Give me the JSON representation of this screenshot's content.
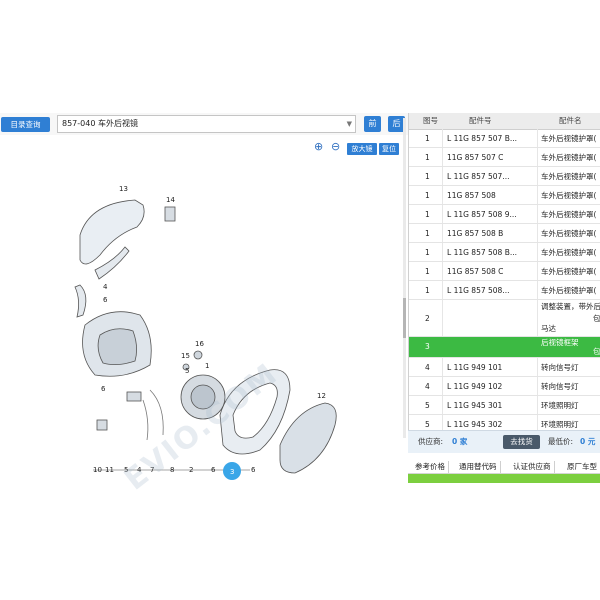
{
  "toolbar": {
    "catalog_label": "目录查询",
    "model_value": "857-040 车外后视镜",
    "prev_label": "前",
    "next_label": "后"
  },
  "diagram_tools": {
    "zoom_in_icon": "zoom-in-icon",
    "zoom_out_icon": "zoom-out-icon",
    "magnifier_label": "放大镜",
    "reset_label": "复位"
  },
  "callouts": [
    "13",
    "14",
    "4",
    "6",
    "16",
    "15",
    "5",
    "1",
    "6",
    "10",
    "11",
    "5",
    "4",
    "7",
    "8",
    "2",
    "6",
    "3",
    "6",
    "12"
  ],
  "table": {
    "headers": [
      "图号",
      "配件号",
      "配件名"
    ],
    "rows": [
      {
        "fig": "1",
        "part": "L 11G 857 507 B...",
        "name": "车外后视镜护罩("
      },
      {
        "fig": "1",
        "part": "11G 857 507 C",
        "name": "车外后视镜护罩("
      },
      {
        "fig": "1",
        "part": "L 11G 857 507...",
        "name": "车外后视镜护罩("
      },
      {
        "fig": "1",
        "part": "11G 857 508",
        "name": "车外后视镜护罩("
      },
      {
        "fig": "1",
        "part": "L 11G 857 508 9...",
        "name": "车外后视镜护罩("
      },
      {
        "fig": "1",
        "part": "11G 857 508 B",
        "name": "车外后视镜护罩("
      },
      {
        "fig": "1",
        "part": "L 11G 857 508 B...",
        "name": "车外后视镜护罩("
      },
      {
        "fig": "1",
        "part": "11G 857 508 C",
        "name": "车外后视镜护罩("
      },
      {
        "fig": "1",
        "part": "L 11G 857 508...",
        "name": "车外后视镜护罩("
      }
    ],
    "tall_row": {
      "fig": "2",
      "part": "",
      "name_line1": "调整装置，带外后",
      "name_line2": "马达",
      "extra": "包"
    },
    "highlight_row": {
      "fig": "3",
      "part": "",
      "name": "后视镜框架",
      "extra": "包"
    },
    "rows_after": [
      {
        "fig": "4",
        "part": "L 11G 949 101",
        "name": "转向信号灯"
      },
      {
        "fig": "4",
        "part": "L 11G 949 102",
        "name": "转向信号灯"
      },
      {
        "fig": "5",
        "part": "L 11G 945 301",
        "name": "环境照明灯"
      },
      {
        "fig": "5",
        "part": "L 11G 945 302",
        "name": "环境照明灯"
      }
    ]
  },
  "supplier": {
    "supplier_label": "供应商:",
    "supplier_count": "0 家",
    "find_label": "去找货",
    "price_label": "最低价:",
    "price_value": "0 元"
  },
  "tabs": [
    "参考价格",
    "通用替代码",
    "认证供应商",
    "原厂车型"
  ],
  "colors": {
    "accent": "#2f7fd4",
    "highlight": "#3cba43",
    "greenbar": "#7ccf3f"
  }
}
